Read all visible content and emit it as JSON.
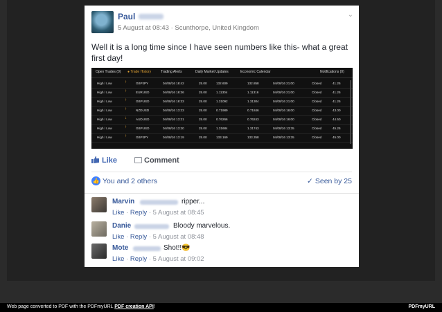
{
  "post": {
    "author": "Paul",
    "meta": "5 August at 08:43 · Scunthorpe, United Kingdom",
    "text": "Well it is a long time since I have seen numbers like this- what a great first day!"
  },
  "screenshot": {
    "tabs": [
      "Open Trades (0)",
      "Trade History",
      "Trading Alerts",
      "Daily Market Updates",
      "Economic Calendar",
      "Notifications (0)"
    ],
    "active_tab": "Trade History",
    "rows": [
      [
        "High / Low",
        "↑",
        "GBPJPY",
        "04/08/16 18:42",
        "25.00",
        "132.609",
        "132.858",
        "04/08/16 21:00",
        "Closed",
        "41.25"
      ],
      [
        "High / Low",
        "↑",
        "EURUSD",
        "04/08/16 18:36",
        "25.00",
        "1.11304",
        "1.11316",
        "04/08/16 21:00",
        "Closed",
        "41.25"
      ],
      [
        "High / Low",
        "↑",
        "GBPUSD",
        "04/08/16 18:33",
        "25.00",
        "1.31092",
        "1.31304",
        "04/08/16 21:00",
        "Closed",
        "41.25"
      ],
      [
        "High / Low",
        "↑",
        "NZDUSD",
        "04/08/16 13:23",
        "25.00",
        "0.71989",
        "0.71846",
        "04/08/16 16:00",
        "Closed",
        "43.00"
      ],
      [
        "High / Low",
        "↓",
        "AUDUSD",
        "04/08/16 13:21",
        "25.00",
        "0.76266",
        "0.76243",
        "04/08/16 16:00",
        "Closed",
        "44.50"
      ],
      [
        "High / Low",
        "↑",
        "GBPUSD",
        "04/08/16 13:20",
        "25.00",
        "1.31684",
        "1.31743",
        "04/08/16 13:35",
        "Closed",
        "45.25"
      ],
      [
        "High / Low",
        "↑",
        "GBPJPY",
        "04/08/16 13:19",
        "25.00",
        "133.169",
        "133.358",
        "04/08/16 13:35",
        "Closed",
        "45.00"
      ]
    ]
  },
  "actions": {
    "like": "Like",
    "comment": "Comment"
  },
  "reactions": {
    "text": "You and 2 others",
    "seen": "Seen by 25"
  },
  "comments": [
    {
      "name": "Marvin",
      "text": "ripper...",
      "like": "Like",
      "reply": "Reply",
      "time": "5 August at 08:45"
    },
    {
      "name": "Danie",
      "text": "Bloody marvelous.",
      "like": "Like",
      "reply": "Reply",
      "time": "5 August at 08:48"
    },
    {
      "name": "Mote",
      "text": "Shot!!😎",
      "like": "Like",
      "reply": "Reply",
      "time": "5 August at 09:02"
    }
  ],
  "footer": {
    "text": "Web page converted to PDF with the PDFmyURL",
    "link": "PDF creation API",
    "suffix": "!",
    "logo": "PDFmyURL"
  },
  "colors": {
    "link": "#365899",
    "accent": "#e8a735",
    "like_badge": "#4080ff"
  }
}
